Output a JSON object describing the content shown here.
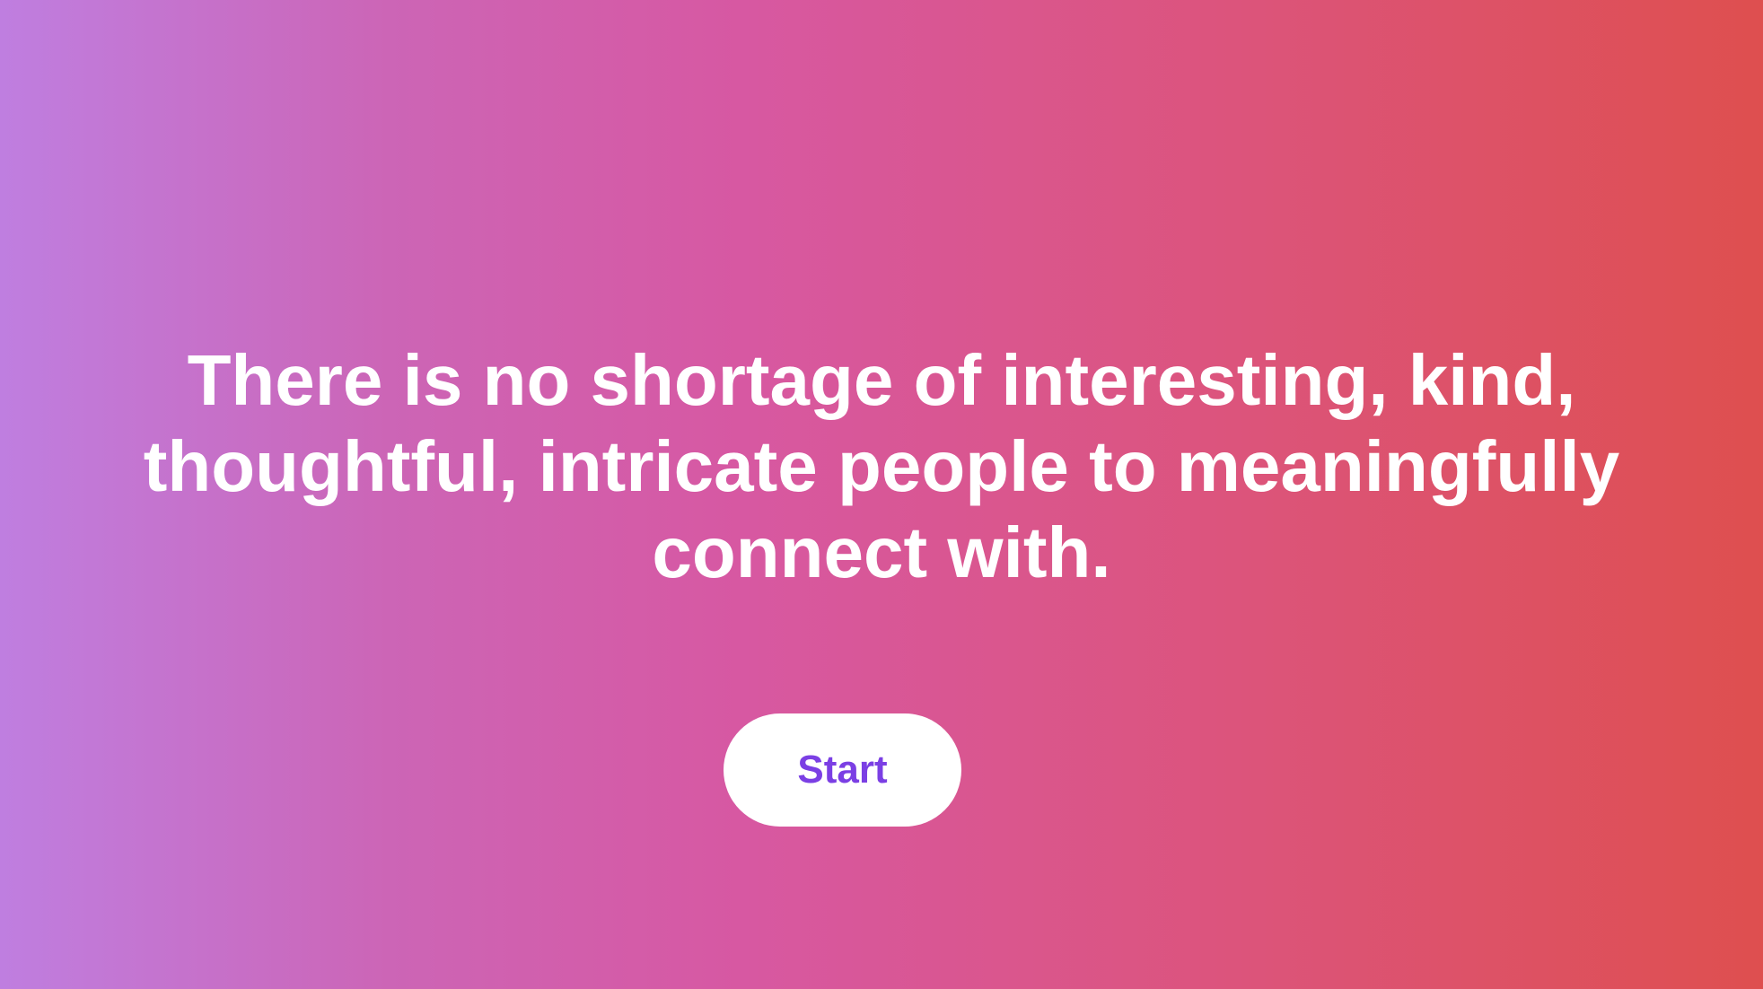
{
  "colors": {
    "gradient_start": "#bf7ee0",
    "gradient_mid": "#d758a2",
    "gradient_end": "#de4f4f",
    "quote_text": "#ffffff",
    "button_bg": "#ffffff",
    "button_text": "#7b3fe4"
  },
  "hero": {
    "quote": "There is no shortage of interesting, kind, thoughtful, intricate people to meaningfully connect with."
  },
  "cta": {
    "label": "Start"
  }
}
